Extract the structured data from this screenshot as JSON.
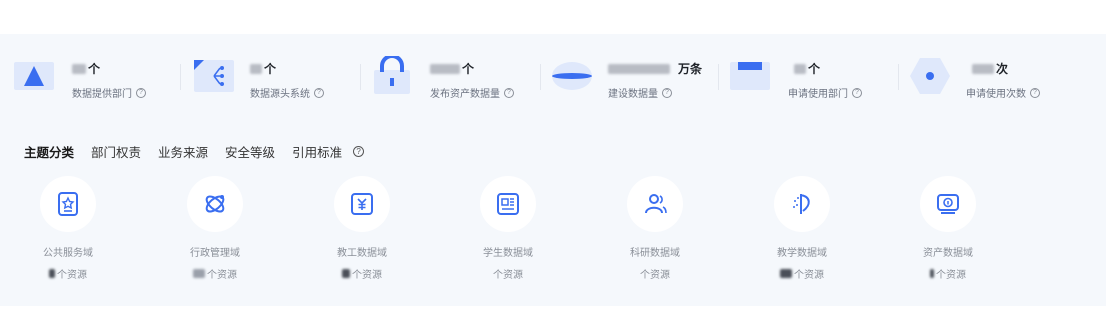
{
  "stats": [
    {
      "value": "个",
      "label": "数据提供部门",
      "blur_w": 14
    },
    {
      "value": "个",
      "label": "数据源头系统",
      "blur_w": 12
    },
    {
      "value": "个",
      "label": "发布资产数据量",
      "blur_w": 30
    },
    {
      "value": "万条",
      "label": "建设数据量",
      "blur_w": 62
    },
    {
      "value": "个",
      "label": "申请使用部门",
      "blur_w": 12
    },
    {
      "value": "次",
      "label": "申请使用次数",
      "blur_w": 22
    }
  ],
  "tabs": [
    "主题分类",
    "部门权责",
    "业务来源",
    "安全等级",
    "引用标准"
  ],
  "domains": [
    {
      "name": "公共服务域",
      "count_suffix": "个资源",
      "icon": "certificate-icon",
      "blur_w": 6
    },
    {
      "name": "行政管理域",
      "count_suffix": "个资源",
      "icon": "satellite-icon",
      "blur_w": 12
    },
    {
      "name": "教工数据域",
      "count_suffix": "个资源",
      "icon": "yuan-wallet-icon",
      "blur_w": 8
    },
    {
      "name": "学生数据域",
      "count_suffix": "个资源",
      "icon": "newspaper-icon",
      "blur_w": 0
    },
    {
      "name": "科研数据域",
      "count_suffix": "个资源",
      "icon": "users-icon",
      "blur_w": 0
    },
    {
      "name": "教学数据域",
      "count_suffix": "个资源",
      "icon": "magic-wand-icon",
      "blur_w": 12
    },
    {
      "name": "资产数据域",
      "count_suffix": "个资源",
      "icon": "monitor-info-icon",
      "blur_w": 4
    }
  ],
  "colors": {
    "accent": "#3a6ef0",
    "panel": "#f5f8fc"
  }
}
